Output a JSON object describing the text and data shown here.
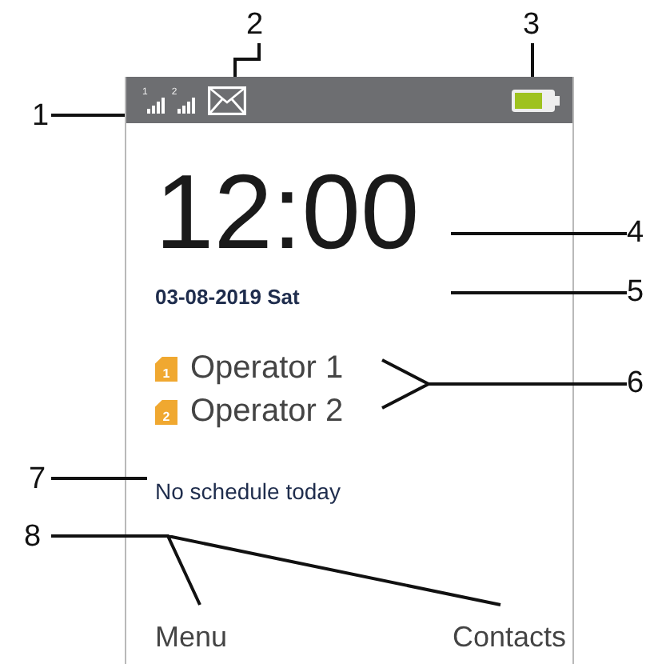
{
  "status_bar": {
    "signals": [
      {
        "label": "1"
      },
      {
        "label": "2"
      }
    ],
    "new_message": true
  },
  "clock": {
    "time": "12:00",
    "date": "03-08-2019 Sat"
  },
  "operators": [
    {
      "sim": "1",
      "name": "Operator 1"
    },
    {
      "sim": "2",
      "name": "Operator 2"
    }
  ],
  "schedule": "No schedule today",
  "softkeys": {
    "left": "Menu",
    "right": "Contacts"
  },
  "callouts": [
    "1",
    "2",
    "3",
    "4",
    "5",
    "6",
    "7",
    "8"
  ]
}
